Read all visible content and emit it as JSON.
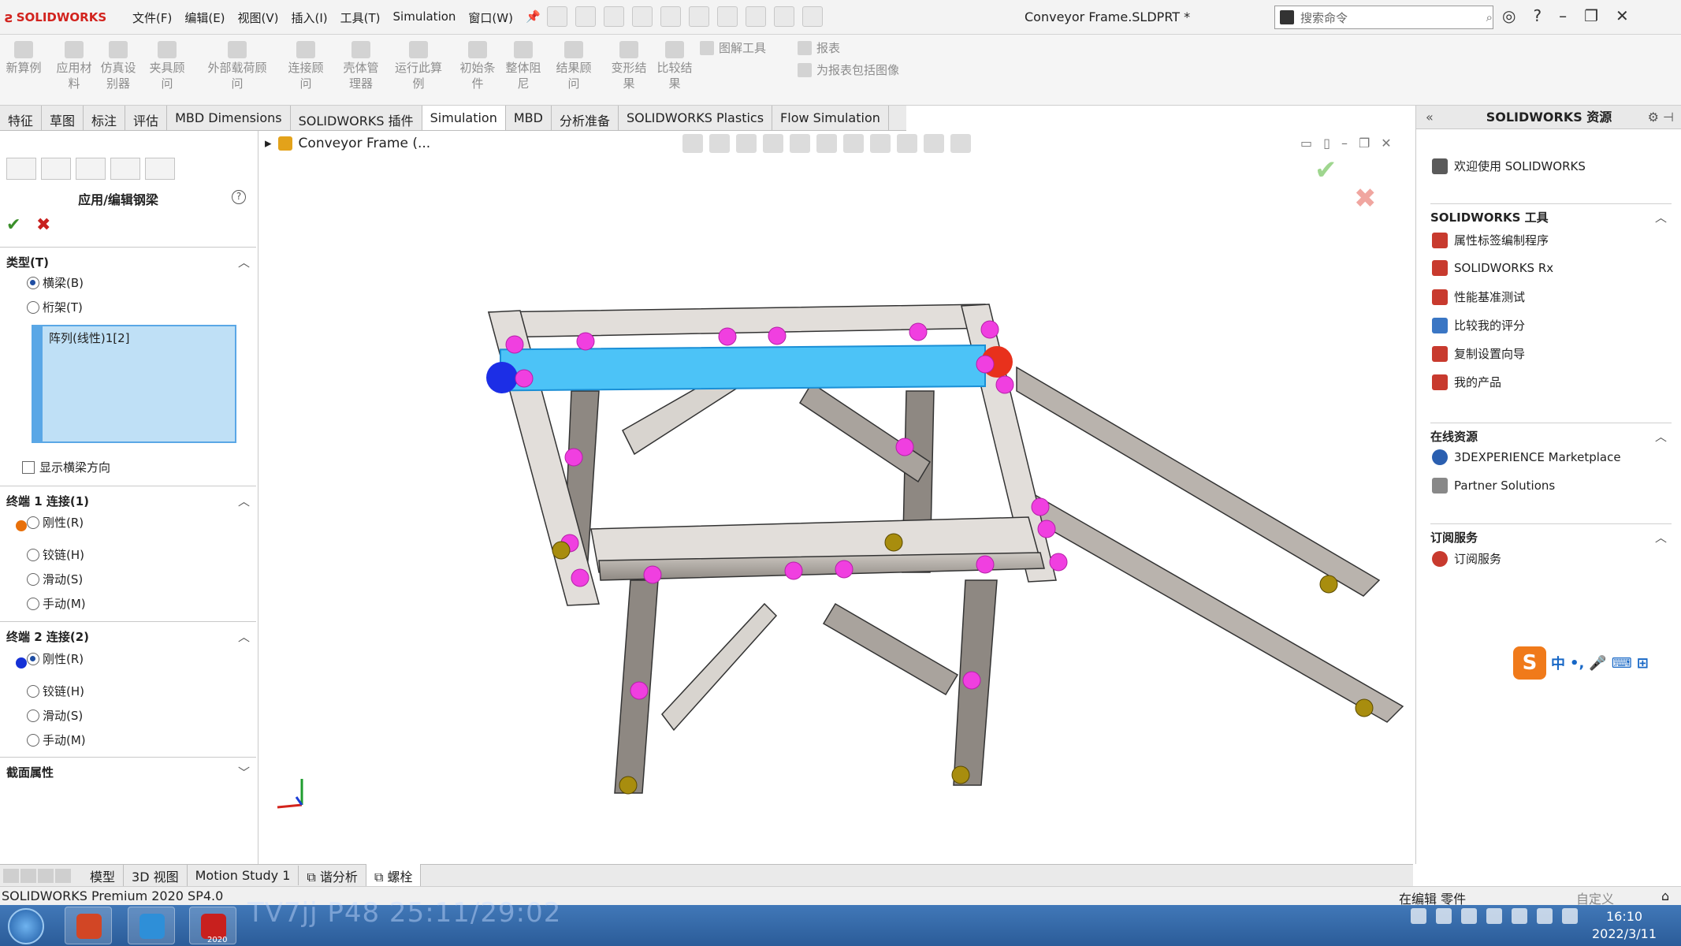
{
  "app": {
    "brand": "SOLIDWORKS",
    "document_title": "Conveyor Frame.SLDPRT *"
  },
  "menu": [
    "文件(F)",
    "编辑(E)",
    "视图(V)",
    "插入(I)",
    "工具(T)",
    "Simulation",
    "窗口(W)"
  ],
  "search": {
    "placeholder": "搜索命令"
  },
  "ribbon": {
    "buttons": [
      "新算例",
      "应用材料",
      "仿真设别器",
      "夹具顾问",
      "外部载荷顾问",
      "连接顾问",
      "壳体管理器",
      "运行此算例",
      "初始条件",
      "整体阻尼",
      "结果顾问",
      "变形结果",
      "比较结果"
    ],
    "small": [
      "图解工具",
      "报表",
      "为报表包括图像"
    ]
  },
  "tabs": [
    "特征",
    "草图",
    "标注",
    "评估",
    "MBD Dimensions",
    "SOLIDWORKS 插件",
    "Simulation",
    "MBD",
    "分析准备",
    "SOLIDWORKS Plastics",
    "Flow Simulation"
  ],
  "active_tab": "Simulation",
  "property_manager": {
    "title": "应用/编辑钢梁",
    "type_section": {
      "header": "类型(T)",
      "options": [
        "横梁(B)",
        "桁架(T)"
      ],
      "selected": "横梁(B)"
    },
    "selection": "阵列(线性)1[2]",
    "show_direction": "显示横梁方向",
    "end1": {
      "header": "终端 1 连接(1)",
      "options": [
        "刚性(R)",
        "铰链(H)",
        "滑动(S)",
        "手动(M)"
      ],
      "selected": "刚性(R)"
    },
    "end2": {
      "header": "终端 2 连接(2)",
      "options": [
        "刚性(R)",
        "铰链(H)",
        "滑动(S)",
        "手动(M)"
      ],
      "selected": "刚性(R)"
    },
    "section": {
      "header": "截面属性"
    }
  },
  "viewport": {
    "tree_label": "Conveyor Frame (...",
    "check": "✔",
    "close": "✖"
  },
  "resources": {
    "title": "SOLIDWORKS 资源",
    "welcome": "欢迎使用 SOLIDWORKS",
    "tools_header": "SOLIDWORKS 工具",
    "tools": [
      "属性标签编制程序",
      "SOLIDWORKS Rx",
      "性能基准测试",
      "比较我的评分",
      "复制设置向导",
      "我的产品"
    ],
    "online_header": "在线资源",
    "online": [
      "3DEXPERIENCE Marketplace",
      "Partner Solutions"
    ],
    "subscription_header": "订阅服务",
    "subscription": [
      "订阅服务"
    ]
  },
  "ime": {
    "items": [
      "中",
      "•,",
      "🎤",
      "⌨",
      "⊞"
    ]
  },
  "bottom_tabs": [
    "模型",
    "3D 视图",
    "Motion Study 1",
    "谐分析",
    "螺栓"
  ],
  "status": {
    "left": "SOLIDWORKS Premium 2020 SP4.0",
    "middle": "在编辑 零件",
    "right": "自定义"
  },
  "taskbar": {
    "overlay_text": "TV7jj P48 25:11/29:02",
    "time": "16:10",
    "date": "2022/3/11",
    "sw_version": "2020"
  }
}
